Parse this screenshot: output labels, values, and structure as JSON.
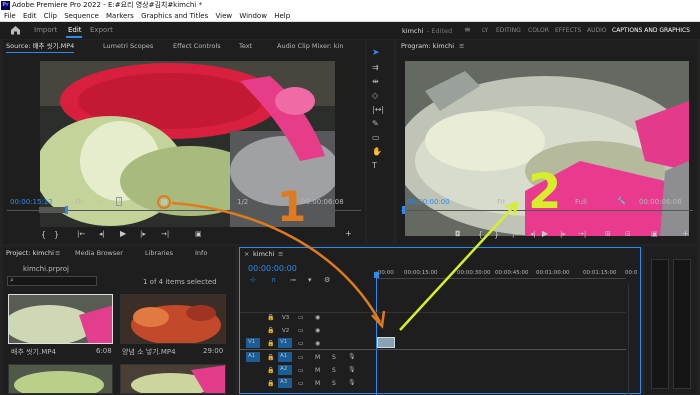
{
  "window": {
    "title": "Adobe Premiere Pro 2022 - E:#요리 영상#김치#kimchi *",
    "app_badge": "Pr"
  },
  "menu": [
    "File",
    "Edit",
    "Clip",
    "Sequence",
    "Markers",
    "Graphics and Titles",
    "View",
    "Window",
    "Help"
  ],
  "workspace_tabs": {
    "home_icon": "home-icon",
    "import": "Import",
    "edit": "Edit",
    "export": "Export"
  },
  "project_title": "kimchi",
  "project_status": "- Edited",
  "workspaces": [
    "LY",
    "EDITING",
    "COLOR",
    "EFFECTS",
    "AUDIO",
    "CAPTIONS AND GRAPHICS"
  ],
  "source_panel": {
    "tabs": [
      "Source: 배추 씻기.MP4",
      "Lumetri Scopes",
      "Effect Controls",
      "Text",
      "Audio Clip Mixer: kin"
    ],
    "timecode": "00:00:15:12",
    "fit": "Fit",
    "resolution": "1/2",
    "duration": "00:00:06:08"
  },
  "program_panel": {
    "tab": "Program: kimchi",
    "timecode": "00:00:00:00",
    "fit": "Fit",
    "resolution": "Full",
    "duration": "00:00:06:08"
  },
  "project_panel": {
    "tabs": [
      "Project: kimchi",
      "Media Browser",
      "Libraries",
      "Info"
    ],
    "file": "kimchi.prproj",
    "items_selected": "1 of 4 items selected",
    "clips": [
      {
        "name": "배추 씻기.MP4",
        "duration": "6:08"
      },
      {
        "name": "양념 소 넣기.MP4",
        "duration": "29:00"
      }
    ]
  },
  "timeline": {
    "tab": "kimchi",
    "timecode": "00:00:00:00",
    "ruler": [
      ":00:00",
      "00:00:15:00",
      "00:00:30:00",
      "00:00:45:00",
      "00:01:00:00",
      "00:01:15:00",
      "00:0"
    ],
    "video_tracks": [
      "V3",
      "V2",
      "V1"
    ],
    "audio_tracks": [
      "A1",
      "A2",
      "A3"
    ],
    "source_patch_v": "V1",
    "source_patch_a": "A1"
  },
  "annotations": {
    "step1": "1",
    "step2": "2",
    "color1": "#e07a1e",
    "color2": "#d6ef2a"
  }
}
